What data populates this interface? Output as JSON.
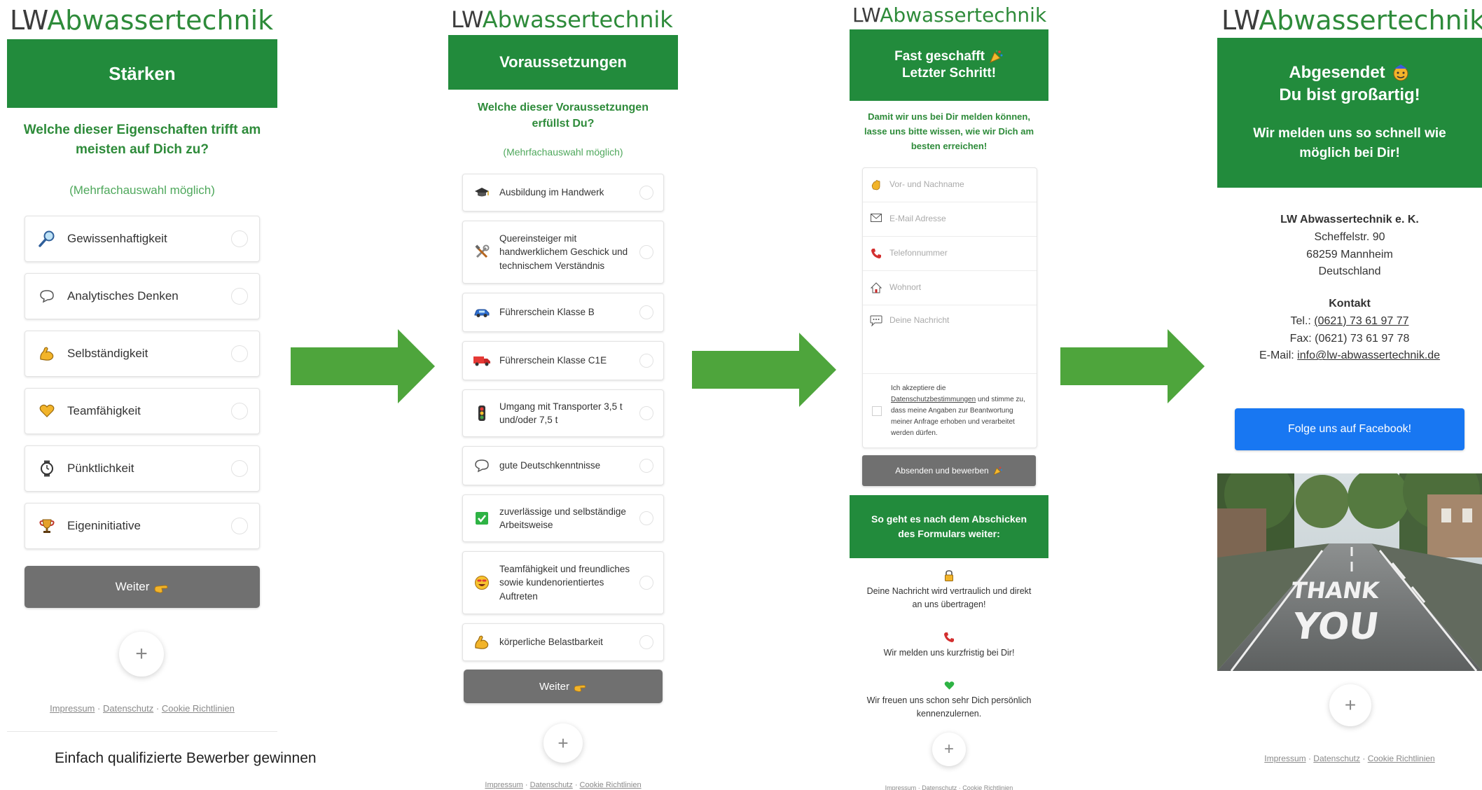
{
  "brand": {
    "lw": "LW",
    "rest": "Abwassertechnik"
  },
  "caption": "Einfach qualifizierte Bewerber gewinnen",
  "screen1": {
    "title": "Stärken",
    "question": "Welche dieser Eigenschaften trifft am meisten auf Dich zu?",
    "hint": "(Mehrfachauswahl möglich)",
    "options": [
      {
        "label": "Gewissenhaftigkeit",
        "icon": "magnifier-icon"
      },
      {
        "label": "Analytisches Denken",
        "icon": "speech-bubble-icon"
      },
      {
        "label": "Selbständigkeit",
        "icon": "flexed-biceps-icon"
      },
      {
        "label": "Teamfähigkeit",
        "icon": "heart-icon"
      },
      {
        "label": "Pünktlichkeit",
        "icon": "watch-icon"
      },
      {
        "label": "Eigeninitiative",
        "icon": "trophy-icon"
      }
    ],
    "button": "Weiter",
    "plus": "+",
    "footer": {
      "impressum": "Impressum",
      "datenschutz": "Datenschutz",
      "cookie": "Cookie Richtlinien",
      "sep": "·"
    }
  },
  "screen2": {
    "title": "Voraussetzungen",
    "question": "Welche dieser Voraussetzungen erfüllst Du?",
    "hint": "(Mehrfachauswahl möglich)",
    "options": [
      {
        "label": "Ausbildung im Handwerk",
        "icon": "graduation-cap-icon"
      },
      {
        "label": "Quereinsteiger mit handwerklichem Geschick und technischem Verständnis",
        "icon": "tools-icon"
      },
      {
        "label": "Führerschein Klasse B",
        "icon": "car-icon"
      },
      {
        "label": "Führerschein Klasse C1E",
        "icon": "truck-icon"
      },
      {
        "label": "Umgang mit Transporter 3,5 t und/oder 7,5 t",
        "icon": "traffic-light-icon"
      },
      {
        "label": "gute Deutschkenntnisse",
        "icon": "speech-bubble-icon"
      },
      {
        "label": "zuverlässige und selbständige Arbeitsweise",
        "icon": "check-box-icon"
      },
      {
        "label": "Teamfähigkeit und freundliches sowie kundenorientiertes Auftreten",
        "icon": "smiley-icon"
      },
      {
        "label": "körperliche Belastbarkeit",
        "icon": "flexed-biceps-icon"
      }
    ],
    "button": "Weiter",
    "plus": "+",
    "footer": {
      "impressum": "Impressum",
      "datenschutz": "Datenschutz",
      "cookie": "Cookie Richtlinien",
      "sep": "·"
    }
  },
  "screen3": {
    "title_line1": "Fast geschafft",
    "title_line2": "Letzter Schritt!",
    "intro": "Damit wir uns bei Dir melden können, lasse uns bitte wissen, wie wir Dich am besten erreichen!",
    "fields": {
      "name": "Vor- und Nachname",
      "email": "E-Mail Adresse",
      "phone": "Telefonnummer",
      "city": "Wohnort",
      "message": "Deine Nachricht"
    },
    "consent_pre": "Ich akzeptiere die",
    "consent_link": "Datenschutzbestimmungen",
    "consent_post": "und stimme zu, dass meine Angaben zur Beantwortung meiner Anfrage erhoben und verarbeitet werden dürfen.",
    "submit": "Absenden und bewerben",
    "next_title": "So geht es nach dem Abschicken des Formulars weiter:",
    "steps": [
      "Deine Nachricht wird vertraulich und direkt an uns übertragen!",
      "Wir melden uns kurzfristig bei Dir!",
      "Wir freuen uns schon sehr Dich persönlich kennenzulernen."
    ],
    "plus": "+",
    "footer": {
      "impressum": "Impressum",
      "datenschutz": "Datenschutz",
      "cookie": "Cookie Richtlinien",
      "sep": "·"
    }
  },
  "screen4": {
    "title_line1": "Abgesendet",
    "title_line2": "Du bist großartig!",
    "subtitle": "Wir melden uns so schnell wie möglich bei Dir!",
    "company": "LW Abwassertechnik e. K.",
    "street": "Scheffelstr. 90",
    "city": "68259 Mannheim",
    "country": "Deutschland",
    "contact_heading": "Kontakt",
    "tel_label": "Tel.:",
    "tel": "(0621) 73 61 97 77",
    "fax": "Fax: (0621) 73 61 97 78",
    "email_label": "E-Mail:",
    "email": "info@lw-abwassertechnik.de",
    "facebook": "Folge uns auf Facebook!",
    "road_text_1": "THANK",
    "road_text_2": "YOU",
    "plus": "+",
    "footer": {
      "impressum": "Impressum",
      "datenschutz": "Datenschutz",
      "cookie": "Cookie Richtlinien",
      "sep": "·"
    }
  },
  "colors": {
    "green": "#228b3c",
    "green_text": "#2e8b3a",
    "arrow": "#4ea53c",
    "facebook": "#1877f2",
    "grey_button": "#707070"
  }
}
